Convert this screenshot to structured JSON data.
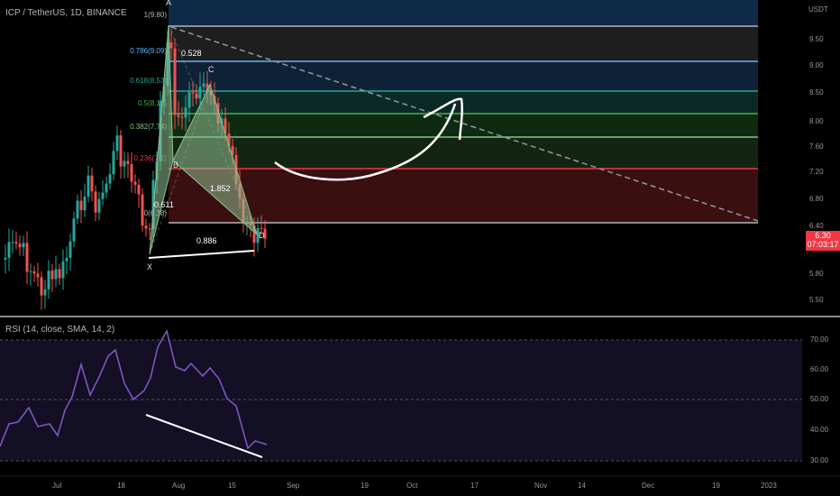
{
  "header": {
    "title": "ICP / TetherUS, 1D, BINANCE"
  },
  "rsi": {
    "title": "RSI (14, close, SMA, 14, 2)"
  },
  "price_axis": {
    "unit": "USDT",
    "ticks": [
      "9.50",
      "9.00",
      "8.50",
      "8.00",
      "7.60",
      "7.20",
      "6.80",
      "6.40",
      "5.80",
      "5.50"
    ],
    "current_price": "6.30",
    "countdown": "07:03:17"
  },
  "rsi_axis": {
    "ticks": [
      "70.00",
      "60.00",
      "50.00",
      "40.00",
      "30.00"
    ]
  },
  "time_axis": {
    "ticks": [
      "Jul",
      "18",
      "Aug",
      "15",
      "Sep",
      "19",
      "Oct",
      "17",
      "Nov",
      "14",
      "Dec",
      "19",
      "2023"
    ]
  },
  "fib_levels": [
    {
      "label": "1(9.80)",
      "color": "#b2b5be"
    },
    {
      "label": "0.786(9.09)",
      "color": "#64b5f6"
    },
    {
      "label": "0.618(8.53)",
      "color": "#26a69a"
    },
    {
      "label": "0.5(8.13)",
      "color": "#4caf50"
    },
    {
      "label": "0.382(7.74)",
      "color": "#81c784"
    },
    {
      "label": "0.236(7.2)",
      "color": "#f23645"
    },
    {
      "label": "0(6.38)",
      "color": "#b2b5be"
    }
  ],
  "pattern": {
    "points": [
      "X",
      "A",
      "B",
      "C",
      "D"
    ],
    "ratios": [
      "0.528",
      "0.611",
      "1.852",
      "0.886"
    ]
  },
  "colors": {
    "up": "#26a69a",
    "down": "#ef5350",
    "rsi_line": "#7e57c2",
    "price_tag": "#f23645"
  }
}
